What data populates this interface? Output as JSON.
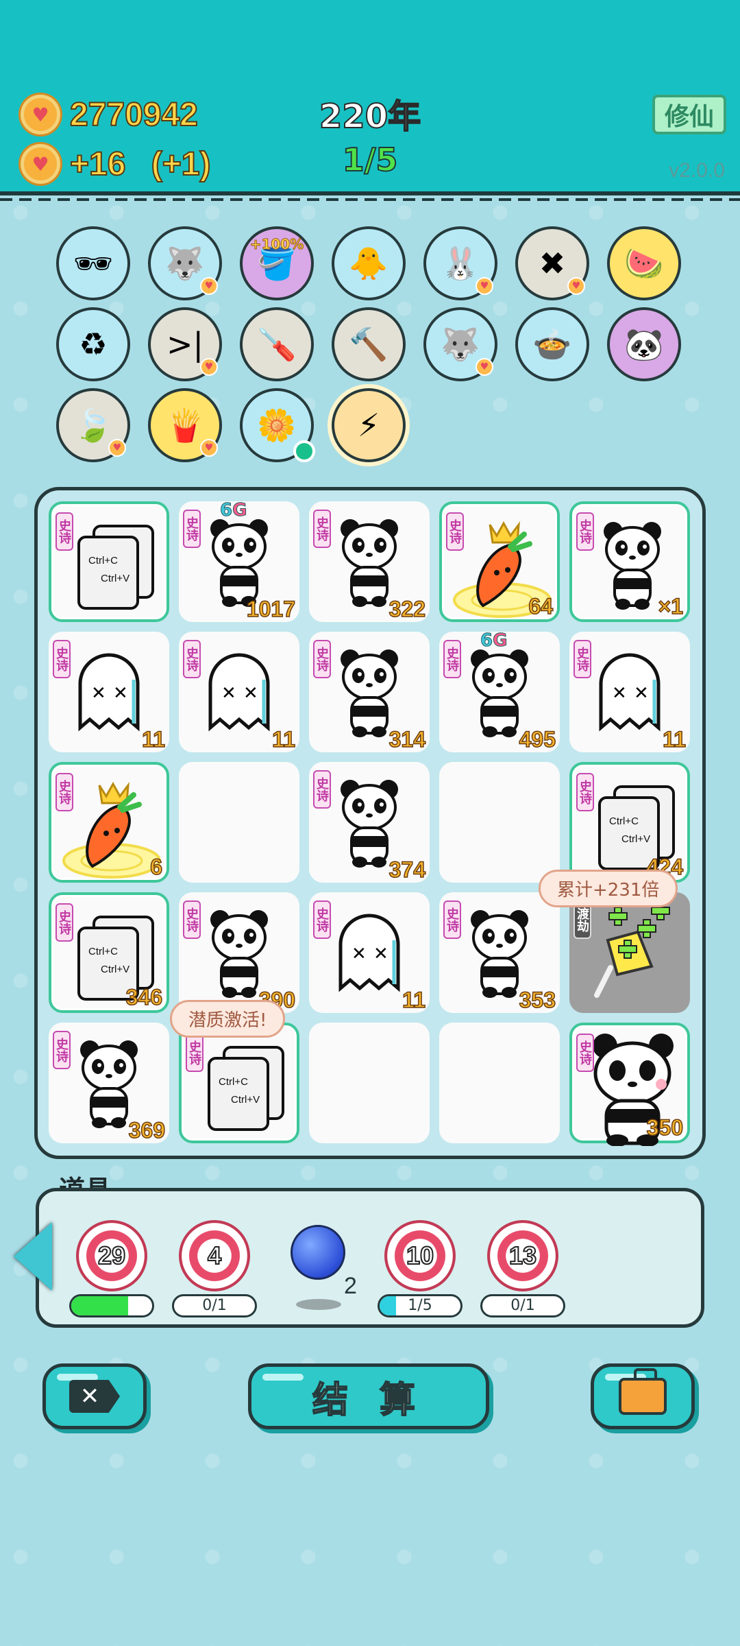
{
  "header": {
    "coins": "2770942",
    "income": "+16",
    "income_bonus": "(+1)",
    "year": "220年",
    "progress": "1/5",
    "xiuxian_label": "修仙",
    "version": "v2.0.0"
  },
  "items": [
    {
      "name": "glasses-fruit-icon",
      "style": "",
      "glyph": "🕶",
      "heart": false
    },
    {
      "name": "husky-icon",
      "style": "",
      "glyph": "🐺",
      "heart": true
    },
    {
      "name": "bucket-icon",
      "style": "purple",
      "glyph": "🪣",
      "caption": "+100%",
      "heart": false
    },
    {
      "name": "chick-egg-icon",
      "style": "",
      "glyph": "🐥",
      "heart": false
    },
    {
      "name": "rabbit-icon",
      "style": "",
      "glyph": "🐰",
      "heart": true
    },
    {
      "name": "remove-tag-icon",
      "style": "gray",
      "glyph": "✖",
      "heart": true
    },
    {
      "name": "fruit-bowl-icon",
      "style": "yellow",
      "glyph": "🍉",
      "heart": false
    },
    {
      "name": "trash-bag-icon",
      "style": "",
      "glyph": "♻",
      "heart": false
    },
    {
      "name": "skip-icon",
      "style": "gray",
      "glyph": ">|",
      "heart": true
    },
    {
      "name": "screwdriver-icon",
      "style": "gray",
      "glyph": "🪛",
      "heart": false
    },
    {
      "name": "hammer-icon",
      "style": "gray",
      "glyph": "🔨",
      "heart": false
    },
    {
      "name": "wolf-icon",
      "style": "",
      "glyph": "🐺",
      "heart": true
    },
    {
      "name": "cooking-pot-icon",
      "style": "",
      "glyph": "🍲",
      "heart": false
    },
    {
      "name": "panda-icon",
      "style": "purple",
      "glyph": "🐼",
      "heart": false
    },
    {
      "name": "leaf-icon",
      "style": "gray",
      "glyph": "🍃",
      "heart": true
    },
    {
      "name": "fries-icon",
      "style": "yellow",
      "glyph": "🍟",
      "heart": true
    },
    {
      "name": "flower-pot-icon",
      "style": "",
      "glyph": "🌼",
      "heart": false,
      "dot": true
    },
    {
      "name": "lightning-icon",
      "style": "lightning",
      "glyph": "⚡",
      "heart": false
    }
  ],
  "board": {
    "tag_label": "史诗",
    "tag_dark_label": "渡劫",
    "cells": [
      {
        "kind": "copy",
        "num": "",
        "framed": true
      },
      {
        "kind": "panda",
        "num": "1017",
        "sixg": true
      },
      {
        "kind": "panda",
        "num": "322"
      },
      {
        "kind": "carrot",
        "num": "64",
        "framed": true
      },
      {
        "kind": "panda",
        "num": "×1",
        "framed": true
      },
      {
        "kind": "ghost",
        "num": "11"
      },
      {
        "kind": "ghost",
        "num": "11"
      },
      {
        "kind": "panda",
        "num": "314"
      },
      {
        "kind": "panda",
        "num": "495",
        "sixg": true
      },
      {
        "kind": "ghost",
        "num": "11"
      },
      {
        "kind": "carrot",
        "num": "6",
        "framed": true
      },
      {
        "kind": "empty",
        "num": ""
      },
      {
        "kind": "panda",
        "num": "374"
      },
      {
        "kind": "empty",
        "num": ""
      },
      {
        "kind": "copy",
        "num": "424",
        "framed": true
      },
      {
        "kind": "copy",
        "num": "346",
        "framed": true
      },
      {
        "kind": "panda",
        "num": "390"
      },
      {
        "kind": "ghost",
        "num": "11"
      },
      {
        "kind": "panda",
        "num": "353"
      },
      {
        "kind": "lolly",
        "num": "",
        "dark": true
      },
      {
        "kind": "panda",
        "num": "369"
      },
      {
        "kind": "copy",
        "num": "",
        "framed": true
      },
      {
        "kind": "empty",
        "num": ""
      },
      {
        "kind": "empty",
        "num": ""
      },
      {
        "kind": "bigpanda",
        "num": "350",
        "framed": true
      }
    ],
    "bubble_total": "累计+231倍",
    "bubble_activate": "潜质激活!",
    "copy_line1": "Ctrl+C",
    "copy_line2": "Ctrl+V",
    "sixg_a": "6",
    "sixg_b": "G"
  },
  "props": {
    "title": "道具",
    "targets": [
      {
        "value": "29",
        "bar": "",
        "fill": 0.7,
        "color": "green"
      },
      {
        "value": "4",
        "bar": "0/1",
        "fill": 0
      },
      {
        "value": "10",
        "bar": "1/5",
        "fill": 0.2,
        "color": "cyan"
      },
      {
        "value": "13",
        "bar": "0/1",
        "fill": 0
      }
    ],
    "ball_count": "2"
  },
  "buttons": {
    "settle": "结 算"
  },
  "colors": {
    "topbar": "#17c1c3",
    "background": "#a9dde6",
    "coin_text": "#ffd54a",
    "epic_tag": "#c03aa4",
    "number": "#f4b32c"
  }
}
